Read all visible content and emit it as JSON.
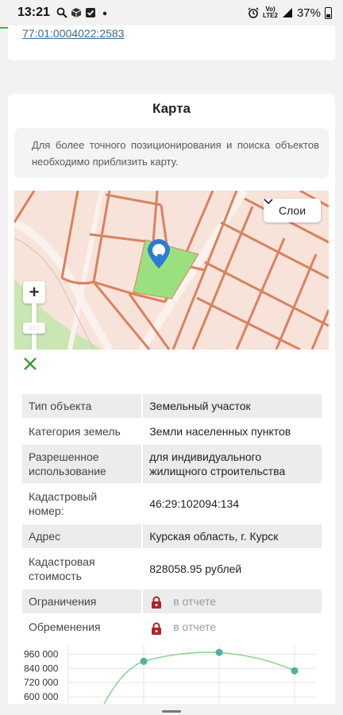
{
  "status_bar": {
    "time": "13:21",
    "icons": [
      "search-icon",
      "box-icon",
      "checkbox-icon",
      "dot-icon"
    ],
    "network": "Vo)) LTE2 4G+",
    "battery": "37%"
  },
  "top_card": {
    "cadastral_link": "77:01:0004022:2583"
  },
  "map_card": {
    "title": "Карта",
    "notice": "Для более точного позиционирования и поиска объектов необходимо приблизить карту.",
    "layers_label": "Слои",
    "zoom_in": "+",
    "zoom_handle": ":::::"
  },
  "details": [
    {
      "key": "Тип объекта",
      "value": "Земельный участок",
      "shaded": true
    },
    {
      "key": "Категория земель",
      "value": "Земли населенных пунктов",
      "shaded": false
    },
    {
      "key": "Разрешенное использование",
      "value": "для индивидуального жилищного строительства",
      "shaded": true
    },
    {
      "key": "Кадастровый номер:",
      "value": "46:29:102094:134",
      "shaded": false
    },
    {
      "key": "Адрес",
      "value": "Курская область, г. Курск",
      "shaded": true
    },
    {
      "key": "Кадастровая стоимость",
      "value": "828058.95 рублей",
      "shaded": false
    },
    {
      "key": "Ограничения",
      "value": "в отчете",
      "shaded": true,
      "locked": true
    },
    {
      "key": "Обременения",
      "value": "в отчете",
      "shaded": false,
      "locked": true
    }
  ],
  "chart_data": {
    "type": "line",
    "yticks": [
      "960 000",
      "840 000",
      "720 000",
      "600 000"
    ],
    "ylim": [
      500000,
      1010000
    ],
    "series": [
      {
        "values": [
          900000,
          975000,
          820000
        ]
      }
    ],
    "colors": {
      "line": "#8fd18f",
      "point": "#4db39b"
    }
  },
  "colors": {
    "accent_green": "#3c9a3c",
    "map_parcel": "#9be07f",
    "map_lines": "#d9825f",
    "marker": "#2b7cd3"
  }
}
